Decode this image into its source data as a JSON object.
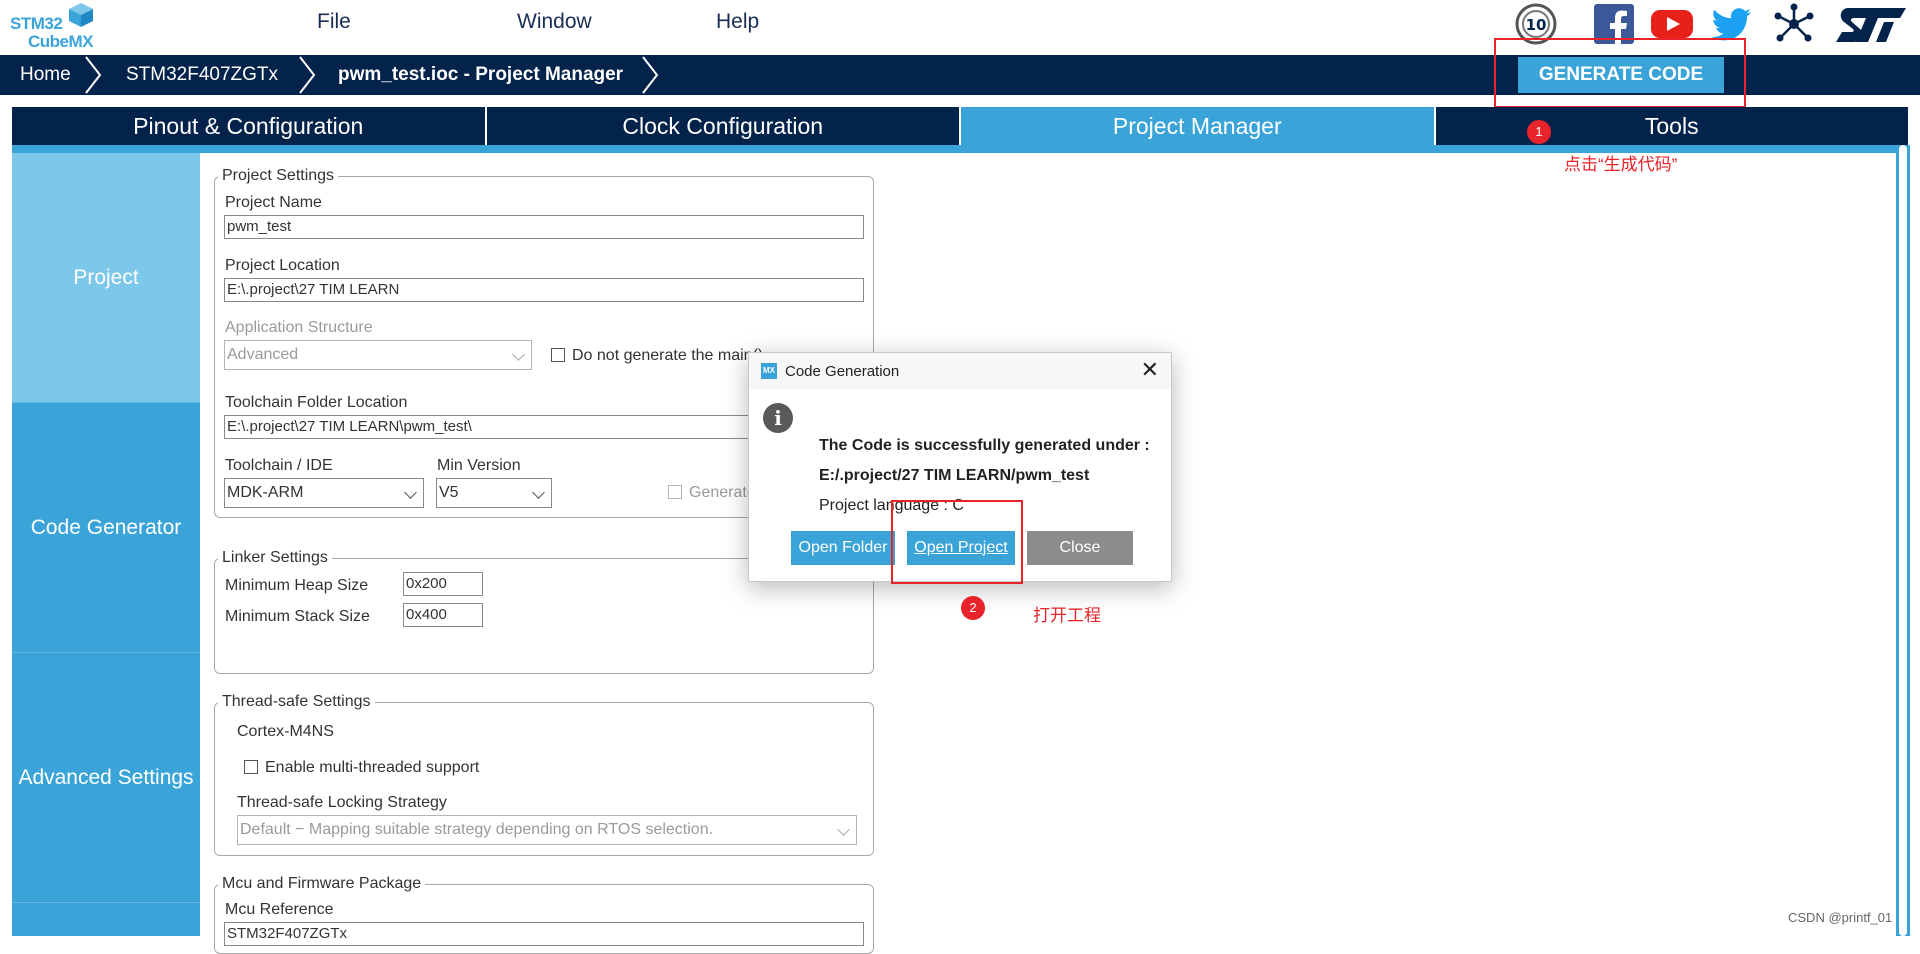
{
  "logo": {
    "line1": "STM32",
    "line2": "CubeMX"
  },
  "menu": [
    "File",
    "Window",
    "Help"
  ],
  "social_icons": [
    "anniversary-10-icon",
    "facebook-icon",
    "youtube-icon",
    "twitter-icon",
    "network-icon",
    "st-logo-icon"
  ],
  "anniversary_badge": "10",
  "breadcrumb": [
    "Home",
    "STM32F407ZGTx",
    "pwm_test.ioc - Project Manager"
  ],
  "generate_button": "GENERATE CODE",
  "tabs": [
    "Pinout & Configuration",
    "Clock Configuration",
    "Project Manager",
    "Tools"
  ],
  "active_tab": "Project Manager",
  "side_nav": [
    "Project",
    "Code Generator",
    "Advanced Settings"
  ],
  "project_settings": {
    "legend": "Project Settings",
    "project_name_label": "Project Name",
    "project_name": "pwm_test",
    "project_location_label": "Project Location",
    "project_location": "E:\\.project\\27 TIM LEARN",
    "app_structure_label": "Application Structure",
    "app_structure": "Advanced",
    "no_main_label": "Do not generate the main()",
    "toolchain_folder_label": "Toolchain Folder Location",
    "toolchain_folder": "E:\\.project\\27 TIM LEARN\\pwm_test\\",
    "toolchain_label": "Toolchain / IDE",
    "toolchain": "MDK-ARM",
    "min_version_label": "Min Version",
    "min_version": "V5",
    "generate_under_root": "Generate"
  },
  "linker_settings": {
    "legend": "Linker Settings",
    "heap_label": "Minimum Heap Size",
    "heap": "0x200",
    "stack_label": "Minimum Stack Size",
    "stack": "0x400"
  },
  "thread_safe": {
    "legend": "Thread-safe Settings",
    "core": "Cortex-M4NS",
    "multithread_label": "Enable multi-threaded support",
    "strategy_label": "Thread-safe Locking Strategy",
    "strategy": "Default  −  Mapping suitable strategy depending on RTOS selection."
  },
  "mcu_package": {
    "legend": "Mcu and Firmware Package",
    "mcu_ref_label": "Mcu Reference",
    "mcu_ref": "STM32F407ZGTx"
  },
  "dialog": {
    "title": "Code Generation",
    "close_glyph": "✕",
    "line1": "The Code is successfully generated under :",
    "line2": "E:/.project/27 TIM LEARN/pwm_test",
    "line3": "Project language : C",
    "open_folder": "Open Folder",
    "open_project": "Open Project",
    "close": "Close"
  },
  "annotations": [
    {
      "number": "1",
      "text": "点击“生成代码”"
    },
    {
      "number": "2",
      "text": "打开工程"
    }
  ],
  "watermark": "CSDN @printf_01",
  "colors": {
    "navy": "#03234b",
    "accent": "#3aa4d8",
    "accent_light": "#7cc7ea",
    "annotation_red": "#e8232a",
    "close_grey": "#8c8c8c"
  }
}
